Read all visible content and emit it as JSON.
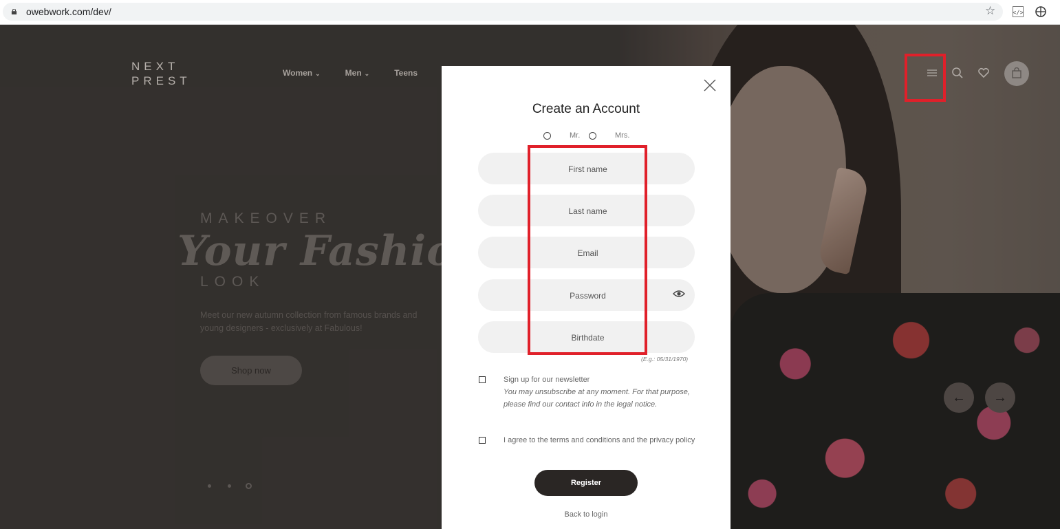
{
  "browser": {
    "url": "owebwork.com/dev/",
    "icons": [
      "lock-icon",
      "star-icon",
      "code-extension-icon",
      "globe-icon"
    ]
  },
  "header": {
    "logo_line1": "NEXT",
    "logo_line2": "PREST",
    "nav": [
      {
        "label": "Women",
        "has_dropdown": true
      },
      {
        "label": "Men",
        "has_dropdown": true
      },
      {
        "label": "Teens",
        "has_dropdown": false
      }
    ],
    "icons": [
      "menu-icon",
      "search-icon",
      "heart-icon",
      "bag-icon"
    ]
  },
  "hero": {
    "kicker": "MAKEOVER",
    "script": "Your Fashion",
    "look": "LOOK",
    "description": "Meet our new autumn collection from famous brands and young designers - exclusively at Fabulous!",
    "cta": "Shop now",
    "slide_count": 3,
    "active_slide": 3,
    "prev_icon": "arrow-left-icon",
    "next_icon": "arrow-right-icon"
  },
  "modal": {
    "title": "Create an Account",
    "gender_options": [
      "Mr.",
      "Mrs."
    ],
    "fields": {
      "first_name": "First name",
      "last_name": "Last name",
      "email": "Email",
      "password": "Password",
      "birthdate": "Birthdate"
    },
    "birthdate_hint": "(E.g.: 05/31/1970)",
    "newsletter_label": "Sign up for our newsletter",
    "newsletter_note": "You may unsubscribe at any moment. For that purpose, please find our contact info in the legal notice.",
    "terms_label": "I agree to the terms and conditions and the privacy policy",
    "register": "Register",
    "back_to_login": "Back to login"
  },
  "colors": {
    "highlight": "#e0202a",
    "button_dark": "#2a2624"
  }
}
